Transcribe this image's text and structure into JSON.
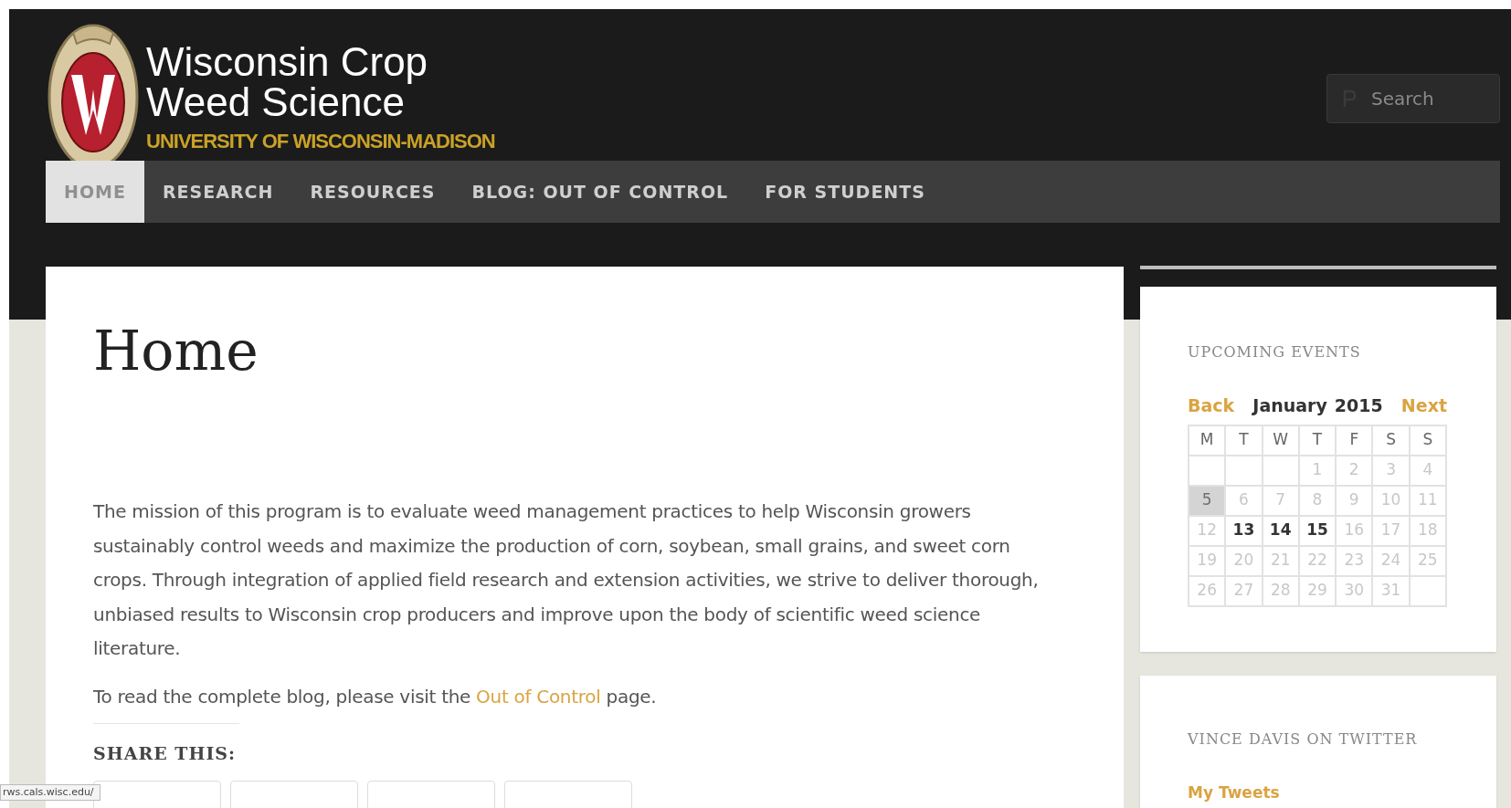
{
  "site": {
    "title_line1": "Wisconsin Crop",
    "title_line2": "Weed Science",
    "subtitle": "UNIVERSITY OF WISCONSIN-MADISON"
  },
  "search": {
    "placeholder": "Search"
  },
  "nav": [
    {
      "label": "HOME",
      "selected": true
    },
    {
      "label": "RESEARCH",
      "selected": false
    },
    {
      "label": "RESOURCES",
      "selected": false
    },
    {
      "label": "BLOG: OUT OF CONTROL",
      "selected": false
    },
    {
      "label": "FOR STUDENTS",
      "selected": false
    }
  ],
  "page": {
    "title": "Home",
    "paragraph": "The mission of this program is to evaluate weed management practices to help Wisconsin growers sustainably control weeds and maximize the production of corn, soybean, small grains, and sweet corn crops. Through integration of applied field research and extension activities, we strive to deliver thorough, unbiased results to Wisconsin crop producers and improve upon the body of scientific weed science literature.",
    "blog_before": "To read the complete blog, please visit the ",
    "blog_link": "Out of Control",
    "blog_after": " page.",
    "share_heading": "SHARE THIS:"
  },
  "events": {
    "heading": "UPCOMING EVENTS",
    "back": "Back",
    "month": "January",
    "year": "2015",
    "next": "Next",
    "weekdays": [
      "M",
      "T",
      "W",
      "T",
      "F",
      "S",
      "S"
    ],
    "weeks": [
      [
        {
          "kind": "empty"
        },
        {
          "kind": "empty"
        },
        {
          "kind": "empty"
        },
        {
          "kind": "plain",
          "day": "1"
        },
        {
          "kind": "plain",
          "day": "2"
        },
        {
          "kind": "plain",
          "day": "3"
        },
        {
          "kind": "plain",
          "day": "4"
        }
      ],
      [
        {
          "kind": "today",
          "day": "5"
        },
        {
          "kind": "plain",
          "day": "6"
        },
        {
          "kind": "plain",
          "day": "7"
        },
        {
          "kind": "plain",
          "day": "8"
        },
        {
          "kind": "plain",
          "day": "9"
        },
        {
          "kind": "plain",
          "day": "10"
        },
        {
          "kind": "plain",
          "day": "11"
        }
      ],
      [
        {
          "kind": "plain",
          "day": "12"
        },
        {
          "kind": "event",
          "day": "13"
        },
        {
          "kind": "event",
          "day": "14"
        },
        {
          "kind": "event",
          "day": "15"
        },
        {
          "kind": "plain",
          "day": "16"
        },
        {
          "kind": "plain",
          "day": "17"
        },
        {
          "kind": "plain",
          "day": "18"
        }
      ],
      [
        {
          "kind": "plain",
          "day": "19"
        },
        {
          "kind": "plain",
          "day": "20"
        },
        {
          "kind": "plain",
          "day": "21"
        },
        {
          "kind": "plain",
          "day": "22"
        },
        {
          "kind": "plain",
          "day": "23"
        },
        {
          "kind": "plain",
          "day": "24"
        },
        {
          "kind": "plain",
          "day": "25"
        }
      ],
      [
        {
          "kind": "plain",
          "day": "26"
        },
        {
          "kind": "plain",
          "day": "27"
        },
        {
          "kind": "plain",
          "day": "28"
        },
        {
          "kind": "plain",
          "day": "29"
        },
        {
          "kind": "plain",
          "day": "30"
        },
        {
          "kind": "plain",
          "day": "31"
        },
        {
          "kind": "empty"
        }
      ]
    ]
  },
  "twitter": {
    "heading": "VINCE DAVIS ON TWITTER",
    "link": "My Tweets"
  },
  "status_url": "rws.cals.wisc.edu/"
}
